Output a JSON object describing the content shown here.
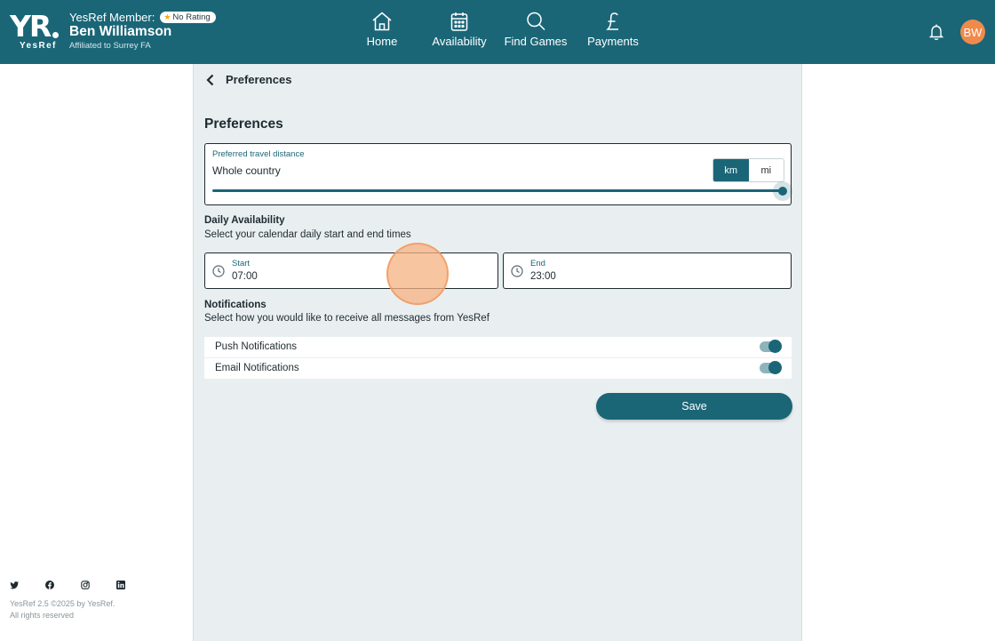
{
  "header": {
    "logo_text": "YR",
    "logo_subtext": "YesRef",
    "member_label": "YesRef Member:",
    "rating_badge": "No Rating",
    "user_name": "Ben Williamson",
    "affiliation": "Affiliated to Surrey FA",
    "avatar_initials": "BW",
    "nav": [
      {
        "label": "Home",
        "icon": "home-icon"
      },
      {
        "label": "Availability",
        "icon": "calendar-icon"
      },
      {
        "label": "Find Games",
        "icon": "search-icon"
      },
      {
        "label": "Payments",
        "icon": "pound-icon"
      }
    ]
  },
  "page": {
    "breadcrumb_title": "Preferences",
    "title": "Preferences",
    "travel": {
      "label": "Preferred travel distance",
      "value": "Whole country",
      "units": [
        "km",
        "mi"
      ],
      "selected_unit": "km",
      "slider_level": 1.0
    },
    "daily": {
      "title": "Daily Availability",
      "description": "Select your calendar daily start and end times",
      "start_label": "Start",
      "start_value": "07:00",
      "end_label": "End",
      "end_value": "23:00"
    },
    "notifications": {
      "title": "Notifications",
      "description": "Select how you would like to receive all messages from YesRef",
      "items": [
        {
          "label": "Push Notifications",
          "enabled": true
        },
        {
          "label": "Email Notifications",
          "enabled": true
        }
      ]
    },
    "save_label": "Save"
  },
  "footer": {
    "social": [
      "twitter-icon",
      "facebook-icon",
      "instagram-icon",
      "linkedin-icon"
    ],
    "version_line1": "YesRef 2.5 ©2025 by YesRef.",
    "version_line2": "All rights reserved"
  },
  "colors": {
    "primary": "#1a6677",
    "avatar": "#f08a4b",
    "panel": "#e9eff1",
    "star": "#f2a81d"
  }
}
